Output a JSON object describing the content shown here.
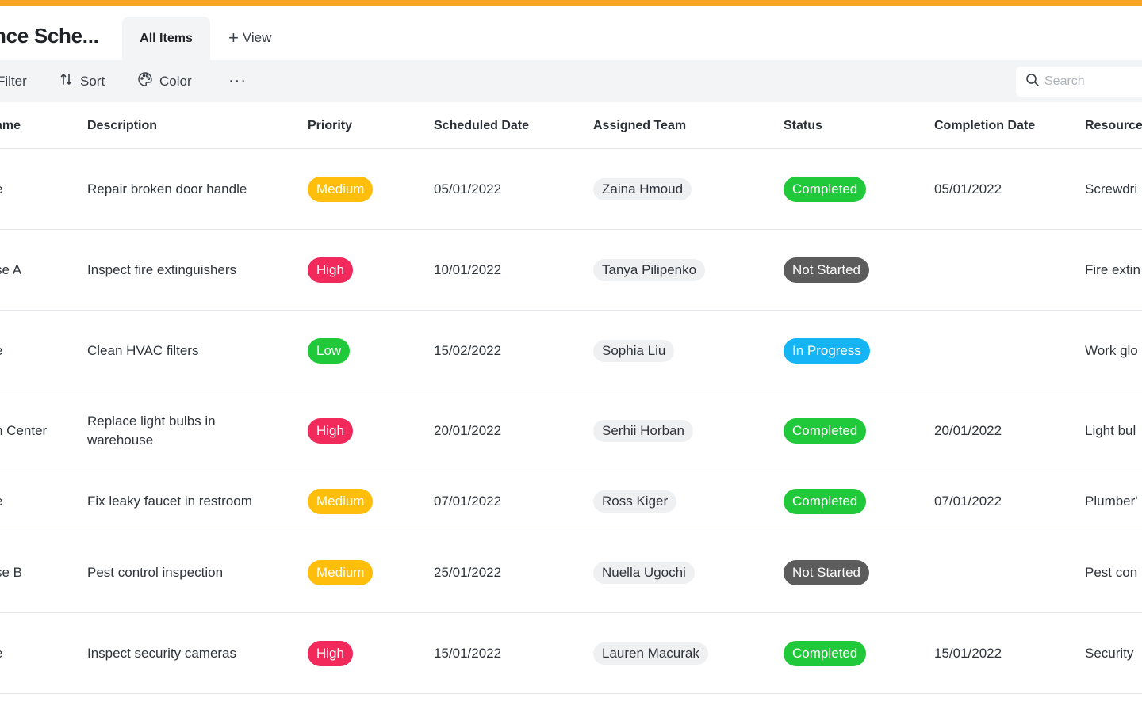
{
  "header": {
    "title": "nce Sche...",
    "tabs": [
      {
        "label": "All Items",
        "active": true
      },
      {
        "label": "View",
        "active": false
      }
    ]
  },
  "toolbar": {
    "filter_label": "Filter",
    "sort_label": "Sort",
    "color_label": "Color",
    "more_label": "···",
    "search_placeholder": "Search"
  },
  "table": {
    "columns": [
      "ame",
      "Description",
      "Priority",
      "Scheduled Date",
      "Assigned Team",
      "Status",
      "Completion Date",
      "Resource"
    ],
    "rows": [
      {
        "name": "e",
        "description": "Repair broken door handle",
        "priority": "Medium",
        "scheduled": "05/01/2022",
        "team": "Zaina Hmoud",
        "status": "Completed",
        "completion": "05/01/2022",
        "resource": "Screwdri"
      },
      {
        "name": "se A",
        "description": "Inspect fire extinguishers",
        "priority": "High",
        "scheduled": "10/01/2022",
        "team": "Tanya Pilipenko",
        "status": "Not Started",
        "completion": "",
        "resource": "Fire extin"
      },
      {
        "name": "e",
        "description": "Clean HVAC filters",
        "priority": "Low",
        "scheduled": "15/02/2022",
        "team": "Sophia Liu",
        "status": "In Progress",
        "completion": "",
        "resource": "Work glo"
      },
      {
        "name": "n Center",
        "description": "Replace light bulbs in warehouse",
        "priority": "High",
        "scheduled": "20/01/2022",
        "team": "Serhii Horban",
        "status": "Completed",
        "completion": "20/01/2022",
        "resource": "Light bul"
      },
      {
        "name": "e",
        "description": "Fix leaky faucet in restroom",
        "priority": "Medium",
        "scheduled": "07/01/2022",
        "team": "Ross Kiger",
        "status": "Completed",
        "completion": "07/01/2022",
        "resource": "Plumber'"
      },
      {
        "name": "se B",
        "description": "Pest control inspection",
        "priority": "Medium",
        "scheduled": "25/01/2022",
        "team": "Nuella Ugochi",
        "status": "Not Started",
        "completion": "",
        "resource": "Pest con"
      },
      {
        "name": "e",
        "description": "Inspect security cameras",
        "priority": "High",
        "scheduled": "15/01/2022",
        "team": "Lauren Macurak",
        "status": "Completed",
        "completion": "15/01/2022",
        "resource": "Security"
      }
    ]
  },
  "colors": {
    "accent_bar": "#f6a623",
    "medium": "#ffbe0b",
    "high": "#f2295b",
    "low": "#1fc93a",
    "completed": "#1fc93a",
    "not_started": "#5c5c5c",
    "in_progress": "#14b4f5"
  }
}
